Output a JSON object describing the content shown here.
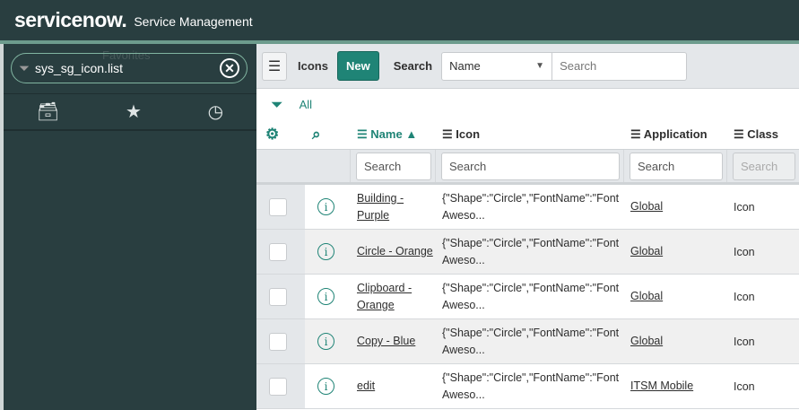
{
  "header": {
    "logo": "servicenow.",
    "title": "Service Management"
  },
  "nav": {
    "filter_value": "sys_sg_icon.list",
    "tooltip": "Favorites",
    "icons": [
      "archive-icon",
      "star-icon",
      "clock-icon"
    ]
  },
  "toolbar": {
    "title": "Icons",
    "new_label": "New",
    "search_label": "Search",
    "field_select": "Name",
    "search_placeholder": "Search"
  },
  "filter": {
    "breadcrumb": "All"
  },
  "columns": [
    {
      "label": "Name",
      "sort": "▲"
    },
    {
      "label": "Icon"
    },
    {
      "label": "Application"
    },
    {
      "label": "Class"
    }
  ],
  "column_search": {
    "placeholder": "Search"
  },
  "rows": [
    {
      "name": "Building - Purple",
      "icon": "{\"Shape\":\"Circle\",\"FontName\":\"Font Aweso...",
      "application": "Global",
      "class": "Icon"
    },
    {
      "name": "Circle - Orange",
      "icon": "{\"Shape\":\"Circle\",\"FontName\":\"Font Aweso...",
      "application": "Global",
      "class": "Icon"
    },
    {
      "name": "Clipboard - Orange",
      "icon": "{\"Shape\":\"Circle\",\"FontName\":\"Font Aweso...",
      "application": "Global",
      "class": "Icon"
    },
    {
      "name": "Copy - Blue",
      "icon": "{\"Shape\":\"Circle\",\"FontName\":\"Font Aweso...",
      "application": "Global",
      "class": "Icon"
    },
    {
      "name": "edit",
      "icon": "{\"Shape\":\"Circle\",\"FontName\":\"Font Aweso...",
      "application": "ITSM Mobile",
      "class": "Icon"
    }
  ]
}
